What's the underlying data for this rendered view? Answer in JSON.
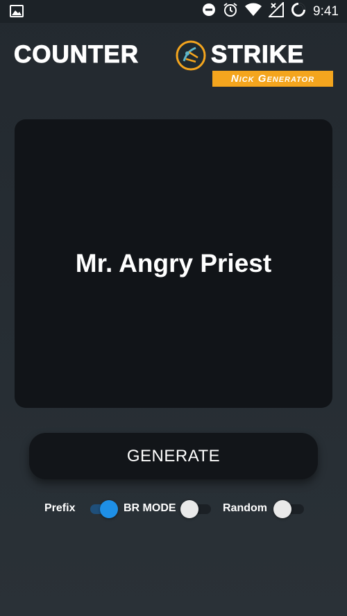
{
  "status_bar": {
    "time": "9:41",
    "icons": [
      "image-notification-icon",
      "do-not-disturb-icon",
      "alarm-icon",
      "wifi-icon",
      "no-signal-icon",
      "battery-icon"
    ]
  },
  "logo": {
    "left_word": "COUNTER",
    "right_word": "STRIKE",
    "badge": "Nick Generator",
    "emblem": "cs-emblem-icon",
    "badge_color": "#f4a51e"
  },
  "nickname": "Mr. Angry Priest",
  "generate_button": {
    "label": "GENERATE"
  },
  "toggles": [
    {
      "label": "Prefix",
      "on": true
    },
    {
      "label": "BR MODE",
      "on": false
    },
    {
      "label": "Random",
      "on": false
    }
  ],
  "colors": {
    "accent": "#1e8fe6",
    "card": "#111418",
    "background": "#262d33"
  }
}
